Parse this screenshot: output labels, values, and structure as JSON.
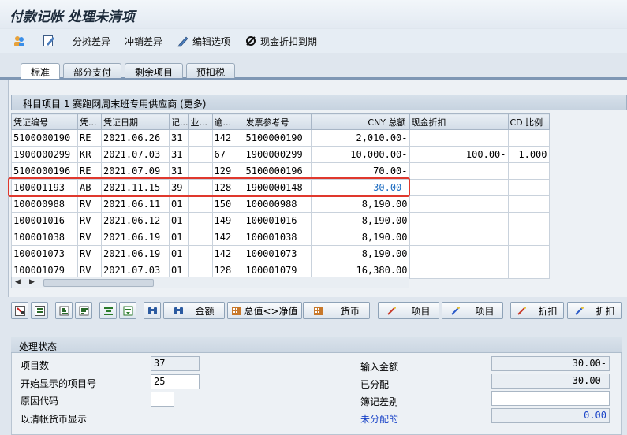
{
  "title": "付款记帐 处理未清项",
  "toolbar": {
    "items": [
      {
        "label": "",
        "icon": "users-icon"
      },
      {
        "label": "",
        "icon": "edit-icon"
      },
      {
        "label": "分摊差异",
        "icon": ""
      },
      {
        "label": "冲销差异",
        "icon": ""
      },
      {
        "label": "编辑选项",
        "icon": "pencil-icon"
      },
      {
        "label": "现金折扣到期",
        "icon": "no-icon"
      }
    ]
  },
  "tabs": [
    "标准",
    "部分支付",
    "剩余项目",
    "预扣税"
  ],
  "table": {
    "title": "科目项目 1 赛跑网周末班专用供应商 (更多)",
    "columns": [
      "凭证编号",
      "凭...",
      "凭证日期",
      "记...",
      "业...",
      "逾...",
      "发票参考号",
      "CNY 总额",
      "现金折扣",
      "CD 比例"
    ],
    "rows": [
      [
        "5100000190",
        "RE",
        "2021.06.26",
        "31",
        "",
        "142",
        "5100000190",
        "2,010.00-",
        "",
        ""
      ],
      [
        "1900000299",
        "KR",
        "2021.07.03",
        "31",
        "",
        "67",
        "1900000299",
        "10,000.00-",
        "100.00-",
        "1.000"
      ],
      [
        "5100000196",
        "RE",
        "2021.07.09",
        "31",
        "",
        "129",
        "5100000196",
        "70.00-",
        "",
        ""
      ],
      [
        "100001193",
        "AB",
        "2021.11.15",
        "39",
        "",
        "128",
        "1900000148",
        "30.00-",
        "",
        ""
      ],
      [
        "100000988",
        "RV",
        "2021.06.11",
        "01",
        "",
        "150",
        "100000988",
        "8,190.00",
        "",
        ""
      ],
      [
        "100001016",
        "RV",
        "2021.06.12",
        "01",
        "",
        "149",
        "100001016",
        "8,190.00",
        "",
        ""
      ],
      [
        "100001038",
        "RV",
        "2021.06.19",
        "01",
        "",
        "142",
        "100001038",
        "8,190.00",
        "",
        ""
      ],
      [
        "100001073",
        "RV",
        "2021.06.19",
        "01",
        "",
        "142",
        "100001073",
        "8,190.00",
        "",
        ""
      ],
      [
        "100001079",
        "RV",
        "2021.07.03",
        "01",
        "",
        "128",
        "100001079",
        "16,380.00",
        "",
        ""
      ]
    ]
  },
  "buttons": {
    "amount": "金额",
    "gross_net": "总值<>净值",
    "currency": "货币",
    "item_activate": "项目",
    "item_deactivate": "项目",
    "discount_activate": "折扣",
    "discount_deactivate": "折扣"
  },
  "status": {
    "title": "处理状态",
    "item_count_label": "项目数",
    "item_count": "37",
    "start_item_label": "开始显示的项目号",
    "start_item": "25",
    "reason_code_label": "原因代码",
    "reason_code": "",
    "show_clearing_currency_label": "以清帐货币显示",
    "amount_entered_label": "输入金额",
    "amount_entered": "30.00-",
    "assigned_label": "已分配",
    "assigned": "30.00-",
    "posting_diff_label": "簿记差别",
    "posting_diff": "",
    "not_assigned_label": "未分配的",
    "not_assigned": "0.00"
  },
  "colors": {
    "highlight_border": "#e0382d",
    "highlight_value": "#1f6ec2",
    "link_blue": "#1a44c8"
  }
}
